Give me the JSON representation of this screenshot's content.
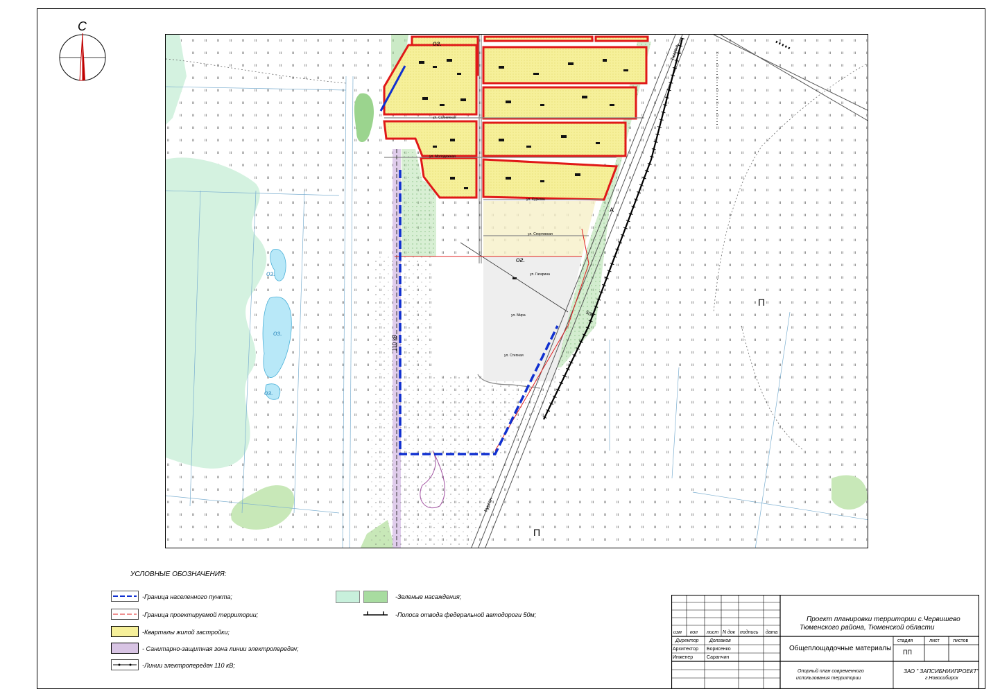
{
  "compass": {
    "north_letter": "С"
  },
  "map": {
    "labels": {
      "letter_p_right": "П",
      "letter_p_bottom": "П",
      "oz1": "оз.",
      "oz2": "оз.",
      "oz3": "оз.",
      "og1": "ог.",
      "og2": "ог.",
      "kv110": "110 кВ",
      "tyumen": "Тюмень",
      "kurgan": "Курган",
      "width50": "50м",
      "st_sovetskaya": "ул. Солнечная",
      "st_molodezh": "ул. Молодежная",
      "st_kurlova": "ул. Куркова",
      "st_sportivnaya": "ул. Спортивная",
      "st_gagarina": "ул. Гагарина",
      "st_mira": "ул. Мира",
      "st_stepnaya": "ул. Степная",
      "road_A": "А"
    }
  },
  "legend": {
    "title": "УСЛОВНЫЕ ОБОЗНАЧЕНИЯ:",
    "items": [
      {
        "label": "-Граница населенного пункта;"
      },
      {
        "label": "-Граница проектируемой территории;"
      },
      {
        "label": "-Кварталы жилой застройки;"
      },
      {
        "label": "- Санитарно-защитная зона линии электропередач;"
      },
      {
        "label": "-Линии электропередач 110 кВ;"
      },
      {
        "label": "-Зеленые насаждения;"
      },
      {
        "label": "-Полоса отвода  федеральной автодороги 50м;"
      }
    ],
    "colors": {
      "boundary": "#1030d0",
      "project": "#e02020",
      "residential": "#f6f09a",
      "sanitary": "#d8c4e4",
      "green_light": "#c8f0dc",
      "green_dark": "#a8dca0"
    }
  },
  "stamp": {
    "title_line1": "Проект планировки территории  с.Червишево",
    "title_line2": "Тюменского района, Тюменской области",
    "cols": [
      "изм",
      "кол",
      "лист",
      "N док",
      "подпись",
      "дата"
    ],
    "roles": [
      {
        "role": "Директор",
        "name": "Долгаков"
      },
      {
        "role": "Архитектор",
        "name": "Борисенко"
      },
      {
        "role": "Инженер",
        "name": "Саранчин"
      }
    ],
    "section": "Общеплощадочные материалы",
    "stage_header": "стадия",
    "sheet_header": "лист",
    "sheets_header": "листов",
    "stage": "ПП",
    "drawing_line1": "Опорный план современного",
    "drawing_line2": "использования территории",
    "org_line1": "ЗАО \" ЗАПСИБНИИПРОЕКТ\"",
    "org_line2": "г.Новосибирск"
  }
}
